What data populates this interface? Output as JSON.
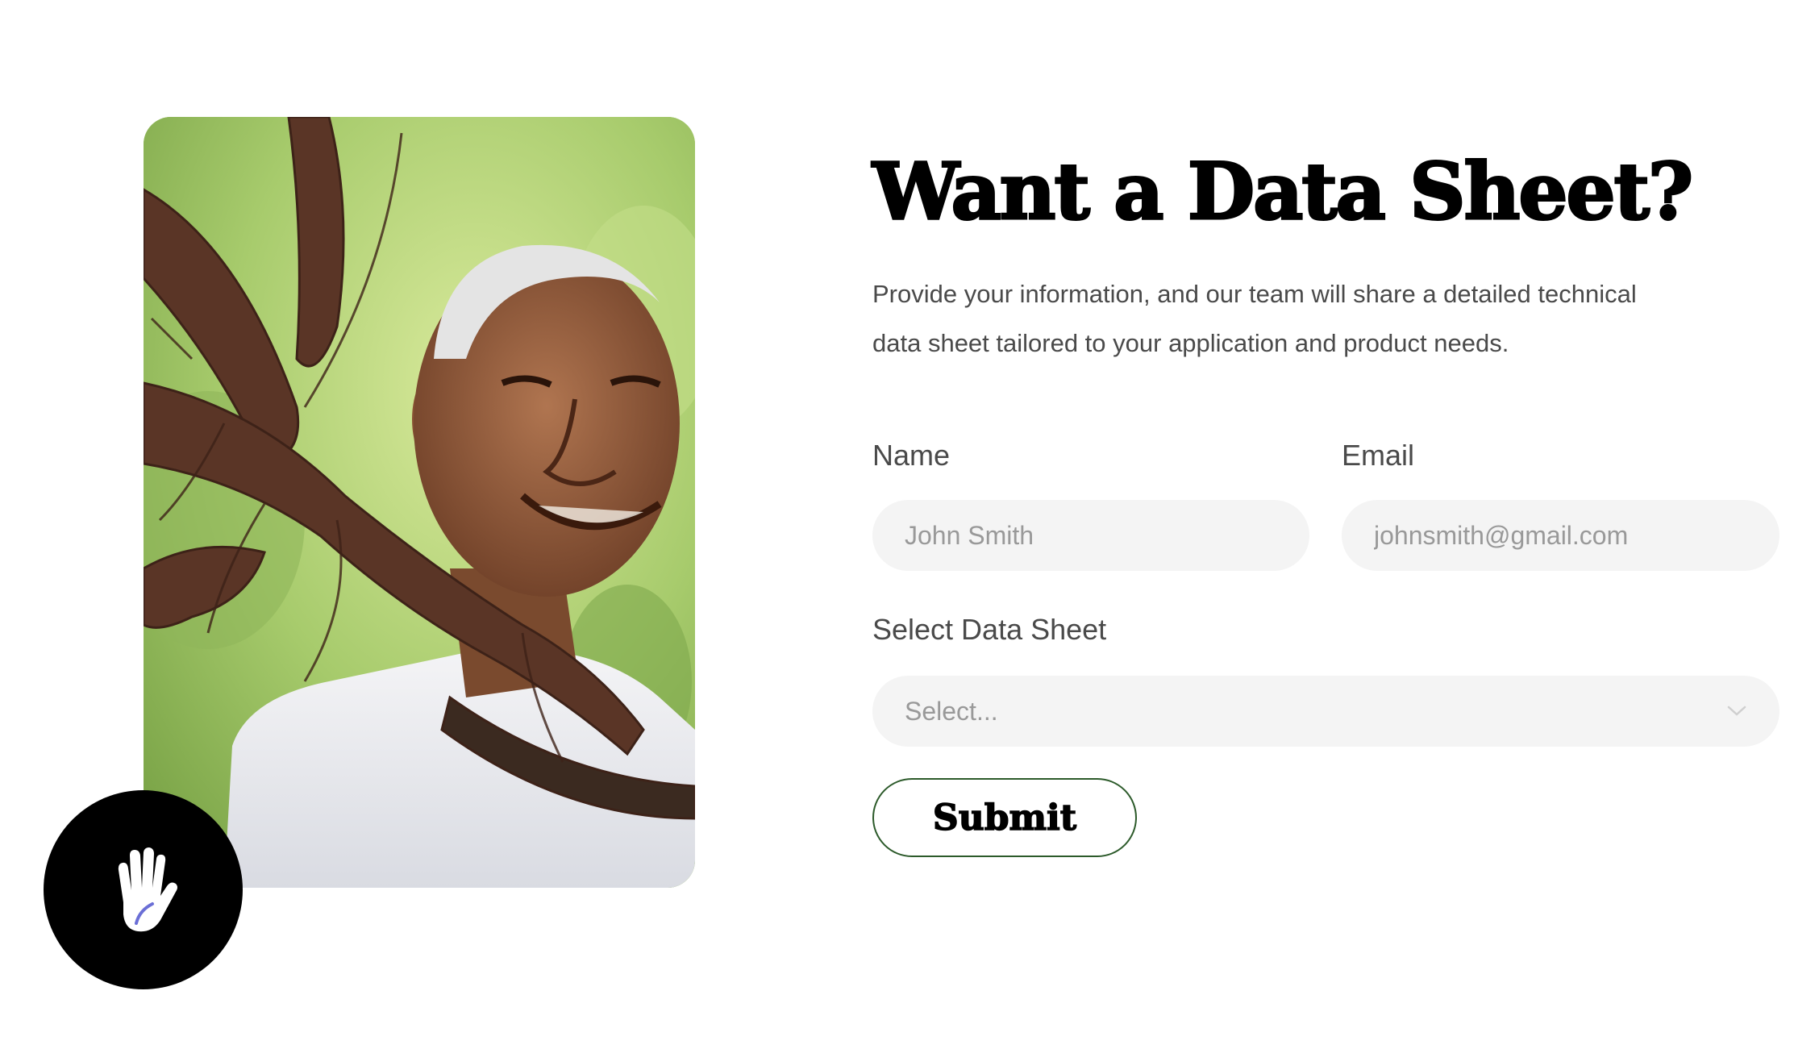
{
  "image": {
    "alt": "Smiling elderly man carrying freshly harvested roots over his shoulder"
  },
  "accessibility": {
    "icon": "hand-icon"
  },
  "form": {
    "title": "Want a Data Sheet?",
    "intro_line1": "Provide your information, and our team will share a detailed technical",
    "intro_line2": "data sheet tailored to your application and product needs.",
    "name_label": "Name",
    "name_placeholder": "John Smith",
    "email_label": "Email",
    "email_placeholder": "johnsmith@gmail.com",
    "datasheet_label": "Select Data Sheet",
    "datasheet_value": "Select...",
    "submit_label": "Submit"
  },
  "colors": {
    "input_bg": "#f4f4f4",
    "submit_border": "#2c5a2a",
    "title": "#000000",
    "body_text": "#4a4a4a"
  }
}
